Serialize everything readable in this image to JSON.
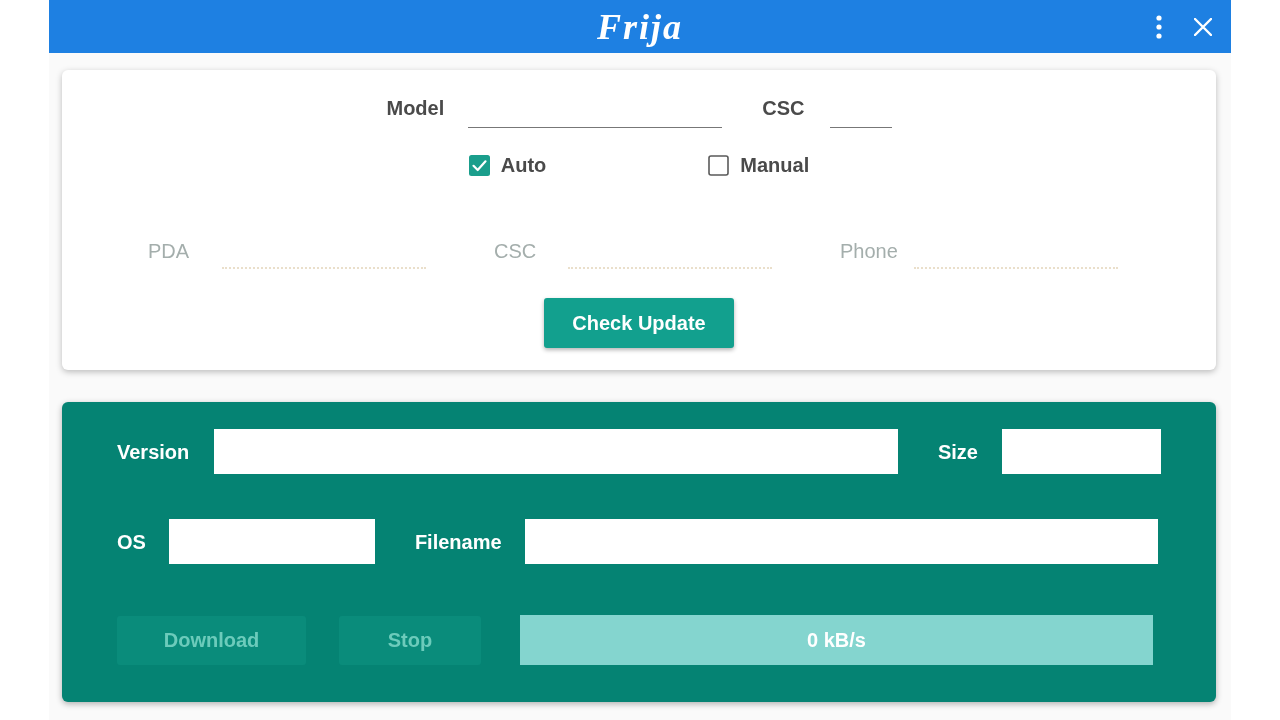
{
  "window": {
    "title": "Frija"
  },
  "search_panel": {
    "fields": [
      {
        "label": "Model",
        "disabled": false
      },
      {
        "label": "CSC",
        "disabled": false
      }
    ],
    "modes": [
      {
        "label": "Auto",
        "checked": true
      },
      {
        "label": "Manual",
        "checked": false
      }
    ],
    "firmware_fields": [
      {
        "label": "PDA",
        "disabled": true
      },
      {
        "label": "CSC",
        "disabled": true
      },
      {
        "label": "Phone",
        "disabled": true
      }
    ],
    "button": {
      "label": "Check Update",
      "disabled": false
    }
  },
  "result_panel": {
    "rows": [
      {
        "fields": [
          {
            "label": "Version"
          },
          {
            "label": "Size"
          }
        ]
      },
      {
        "fields": [
          {
            "label": "OS"
          },
          {
            "label": "Filename"
          }
        ]
      }
    ],
    "buttons": [
      {
        "label": "Download",
        "disabled": true
      },
      {
        "label": "Stop",
        "disabled": true
      }
    ],
    "progress": {
      "reading": "0 kB/s"
    }
  }
}
